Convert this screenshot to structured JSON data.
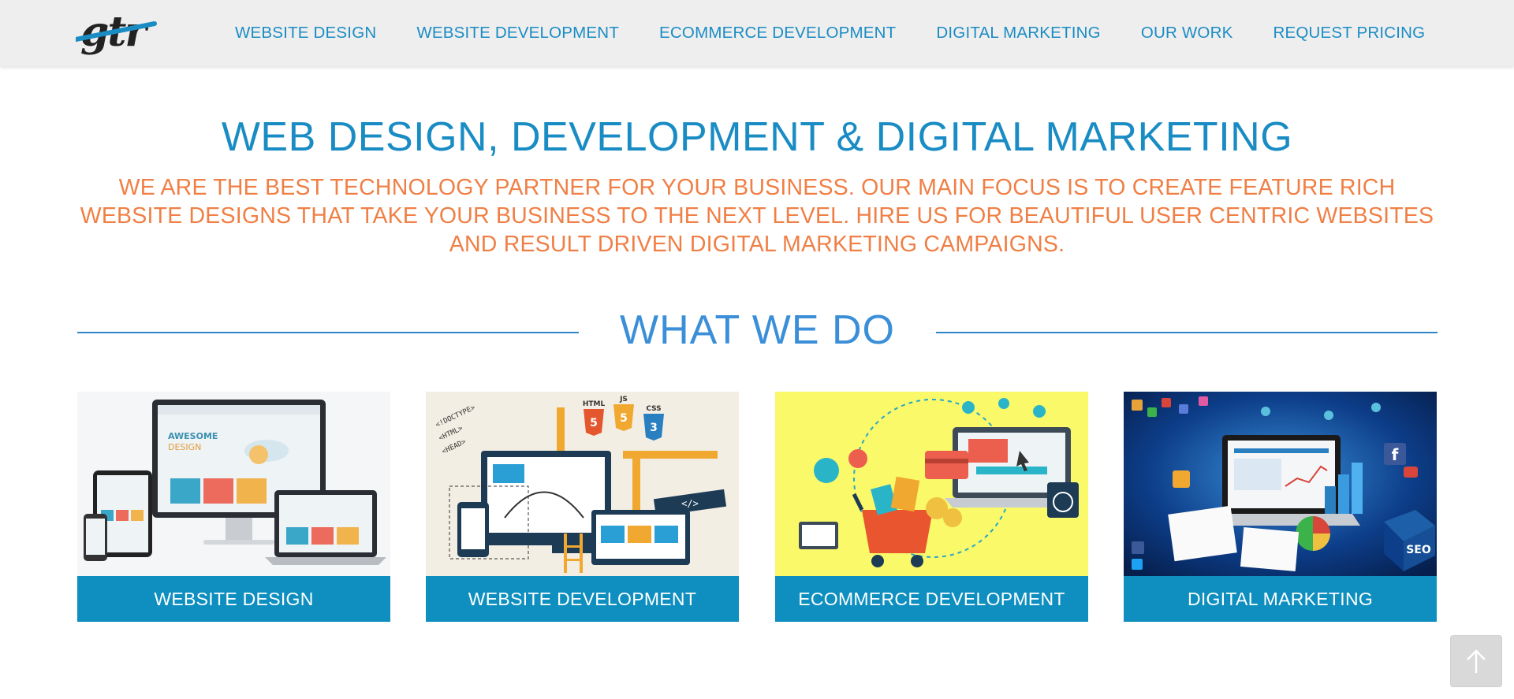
{
  "header": {
    "logo_text": "gtr",
    "nav": [
      "WEBSITE DESIGN",
      "WEBSITE DEVELOPMENT",
      "ECOMMERCE DEVELOPMENT",
      "DIGITAL MARKETING",
      "OUR WORK",
      "REQUEST PRICING"
    ]
  },
  "hero": {
    "title": "WEB DESIGN, DEVELOPMENT & DIGITAL MARKETING",
    "subtitle": "WE ARE THE BEST TECHNOLOGY PARTNER FOR YOUR BUSINESS. OUR MAIN FOCUS IS TO CREATE FEATURE RICH WEBSITE DESIGNS THAT TAKE YOUR BUSINESS TO THE NEXT LEVEL. HIRE US FOR BEAUTIFUL USER CENTRIC WEBSITES AND RESULT DRIVEN DIGITAL MARKETING CAMPAIGNS."
  },
  "section": {
    "title": "WHAT WE DO"
  },
  "services": [
    {
      "label": "WEBSITE DESIGN",
      "image": "responsive-devices-illustration",
      "mockup_heading": "AWESOME",
      "mockup_sub": "DESIGN"
    },
    {
      "label": "WEBSITE DEVELOPMENT",
      "image": "web-development-illustration",
      "badges": [
        "HTML",
        "JS",
        "CSS"
      ]
    },
    {
      "label": "ECOMMERCE DEVELOPMENT",
      "image": "ecommerce-shopping-cart-illustration"
    },
    {
      "label": "DIGITAL MARKETING",
      "image": "digital-marketing-laptop-illustration",
      "seo_text": "SEO"
    }
  ],
  "back_to_top": {
    "icon": "arrow-up-icon"
  },
  "colors": {
    "brand_blue": "#1a8cc4",
    "accent_orange": "#f07f45",
    "card_label_bg": "#0e8fc0",
    "header_bg": "#eeeeee"
  }
}
